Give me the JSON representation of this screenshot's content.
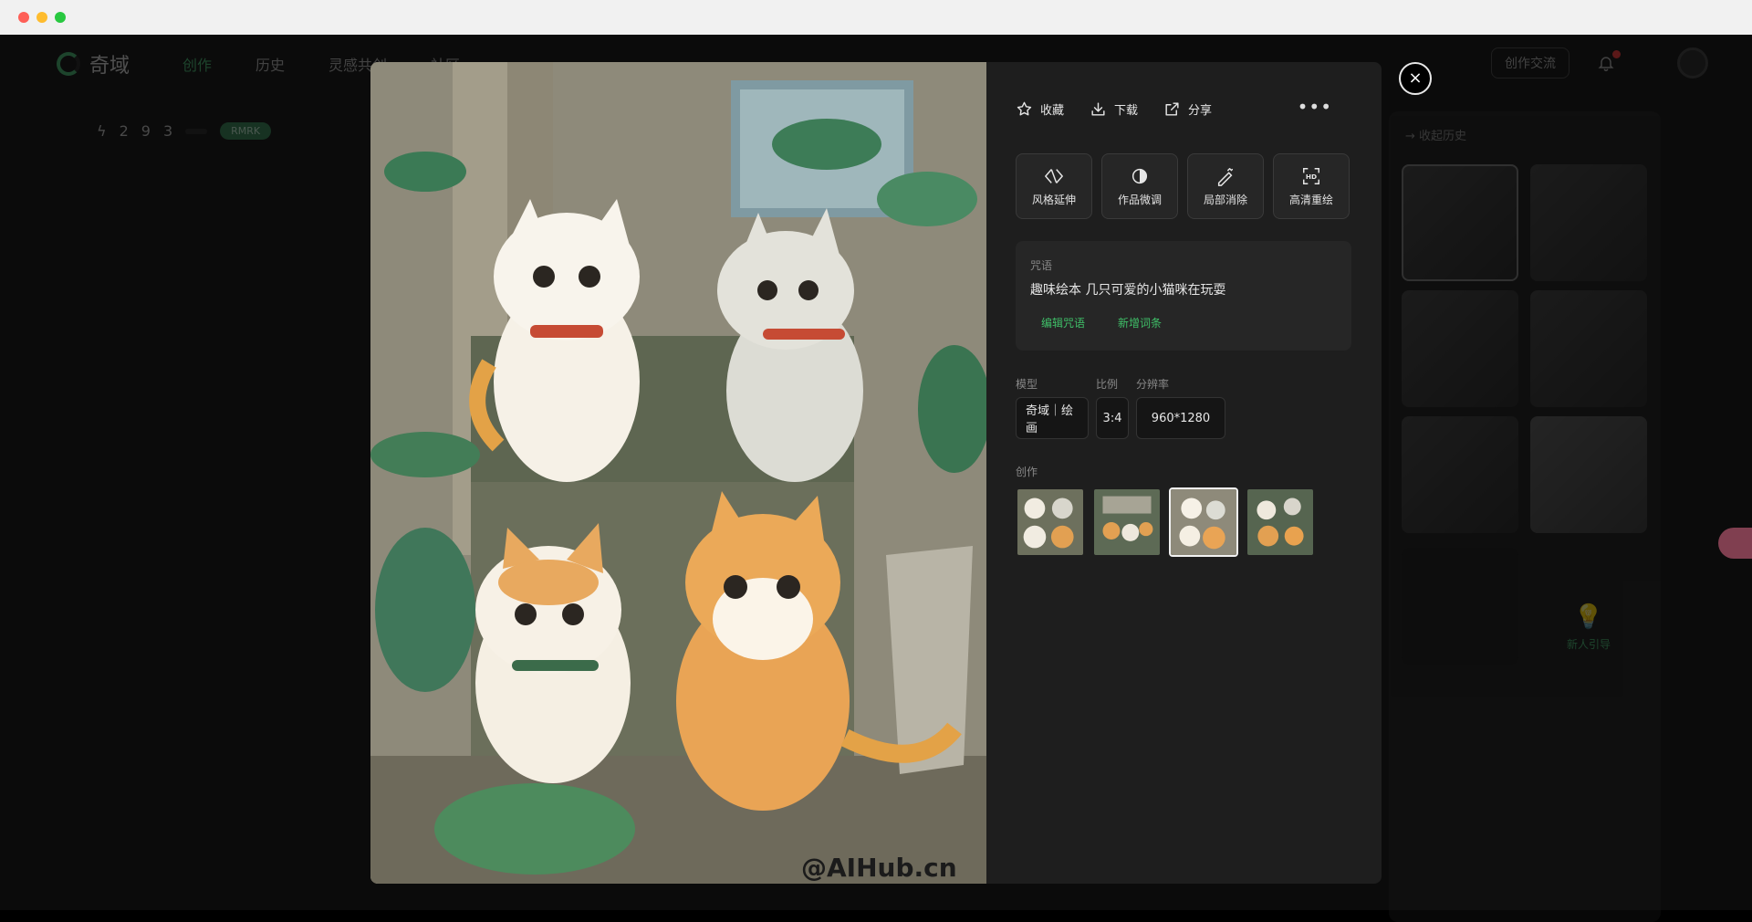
{
  "window": {
    "dots": [
      "#fe5f57",
      "#febc2e",
      "#28c840"
    ]
  },
  "app": {
    "brand": "奇域",
    "nav": [
      {
        "label": "创作",
        "active": true
      },
      {
        "label": "历史",
        "active": false
      },
      {
        "label": "灵感共创",
        "active": false
      },
      {
        "label": "社区",
        "active": false
      }
    ],
    "community_button": "创作交流",
    "counter": {
      "digits": [
        "2",
        "9",
        "3"
      ],
      "chips": [
        "",
        "RMRK"
      ]
    }
  },
  "history_panel": {
    "title": "收起历史",
    "newbie_guide": "新人引导"
  },
  "modal": {
    "watermark": "@AIHub.cn",
    "actions": {
      "favorite": "收藏",
      "download": "下载",
      "share": "分享"
    },
    "tools": [
      {
        "label": "风格延伸",
        "icon": "style-extend-icon"
      },
      {
        "label": "作品微调",
        "icon": "fine-tune-icon"
      },
      {
        "label": "局部消除",
        "icon": "erase-icon"
      },
      {
        "label": "高清重绘",
        "icon": "hd-redraw-icon"
      }
    ],
    "prompt": {
      "label": "咒语",
      "text": "趣味绘本 几只可爱的小猫咪在玩耍",
      "edit_link": "编辑咒语",
      "add_link": "新增词条"
    },
    "params": {
      "model_label": "模型",
      "model_value": "奇域｜绘画",
      "ratio_label": "比例",
      "ratio_value": "3:4",
      "resolution_label": "分辨率",
      "resolution_value": "960*1280"
    },
    "creations_label": "创作",
    "selected_thumb_index": 2,
    "close_label": "×"
  },
  "colors": {
    "accent": "#3fbf68",
    "modal_bg": "#1e1e1e"
  }
}
